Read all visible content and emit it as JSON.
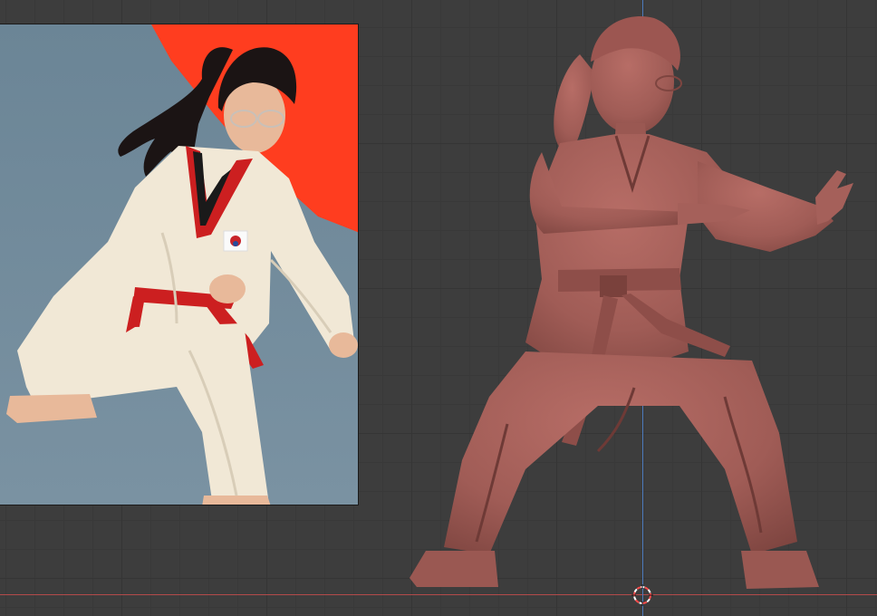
{
  "viewport": {
    "background_color": "#3d3d3d",
    "grid_color": "#353535",
    "x_axis_color": "#b34a4a",
    "z_axis_color": "#4d7bbd"
  },
  "reference_image": {
    "subject": "reference-photo",
    "floor_color": "#6f8797",
    "mat_color": "#ff3d1f"
  },
  "sculpt_model": {
    "material_color": "#a05c56",
    "shadow_color": "#6e3a36"
  },
  "cursor": {
    "icon": "3d-cursor-icon"
  }
}
